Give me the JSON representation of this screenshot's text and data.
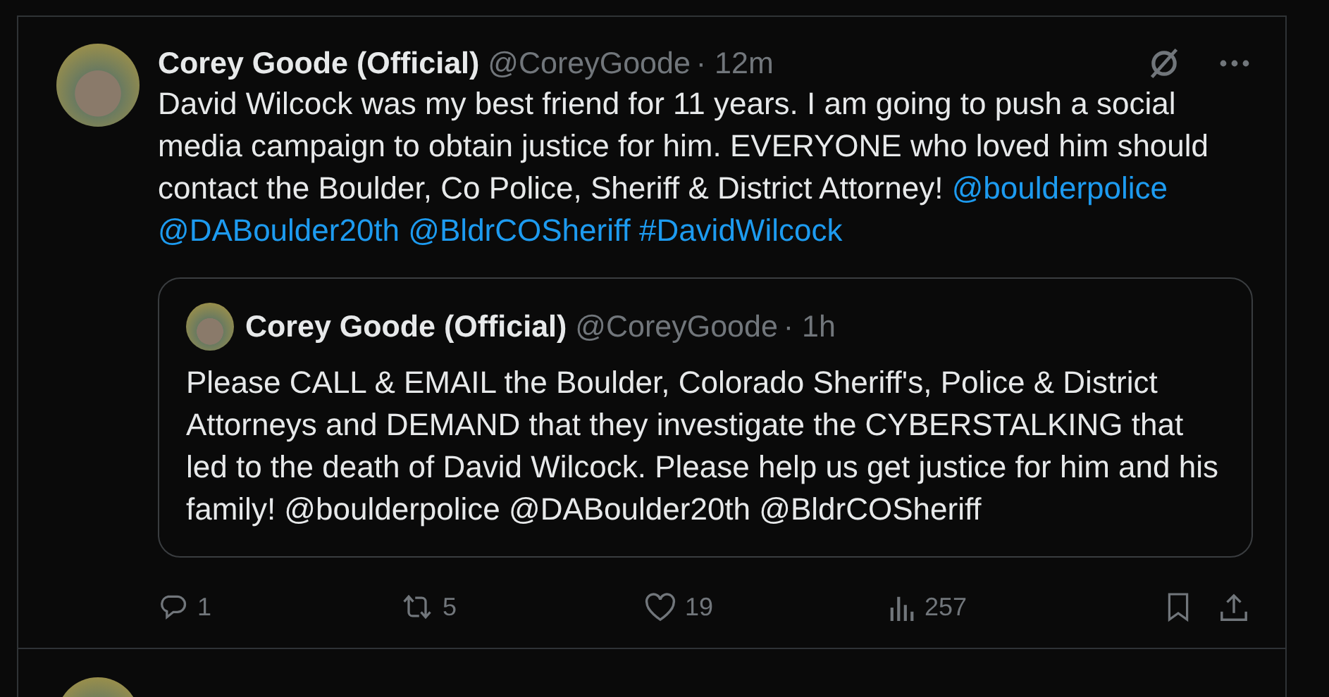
{
  "tweet": {
    "author": {
      "name": "Corey Goode (Official)",
      "handle": "@CoreyGoode",
      "time": "· 12m"
    },
    "body": [
      {
        "kind": "text",
        "text": "David Wilcock was my best friend for 11 years. I am going to push a social media campaign to obtain justice for him. EVERYONE who loved him should contact the Boulder, Co Police, Sheriff & District Attorney!"
      },
      {
        "kind": "link",
        "text": "@boulderpolice"
      },
      {
        "kind": "link",
        "text": "@DABoulder20th"
      },
      {
        "kind": "link",
        "text": "@BldrCOSheriff"
      },
      {
        "kind": "link",
        "text": "#DavidWilcock"
      }
    ],
    "quote": {
      "author": {
        "name": "Corey Goode (Official)",
        "handle": "@CoreyGoode",
        "time": "· 1h"
      },
      "text": "Please CALL & EMAIL the Boulder, Colorado Sheriff's, Police & District Attorneys and DEMAND that they investigate the CYBERSTALKING that led to the death of David Wilcock. Please help us get justice for him and his family! @boulderpolice @DABoulder20th @BldrCOSheriff"
    },
    "actions": [
      {
        "kind": "reply",
        "count": "1"
      },
      {
        "kind": "retweet",
        "count": "5"
      },
      {
        "kind": "like",
        "count": "19"
      },
      {
        "kind": "views",
        "count": "257"
      },
      {
        "kind": "bookmark"
      },
      {
        "kind": "share"
      }
    ]
  }
}
